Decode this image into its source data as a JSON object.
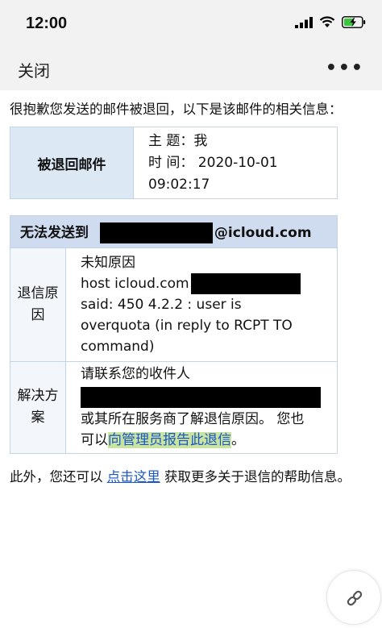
{
  "status": {
    "time": "12:00"
  },
  "nav": {
    "close_label": "关闭",
    "more_label": "•••"
  },
  "intro": "很抱歉您发送的邮件被退回，以下是该邮件的相关信息：",
  "bounced_mail": {
    "label": "被退回邮件",
    "subject_line": "主 题：我",
    "time_line_1": "时 间： 2020-10-01",
    "time_line_2": "09:02:17"
  },
  "failure": {
    "header_prefix": "无法发送到",
    "header_suffix": "@icloud.com",
    "reason_label_1": "退信原",
    "reason_label_2": "因",
    "reason_line_1": "未知原因",
    "reason_line_2": "host icloud.com",
    "reason_line_3": "said: 450 4.2.2 : user is",
    "reason_line_4": "overquota (in reply to RCPT TO",
    "reason_line_5": "command)",
    "solution_label_1": "解决方",
    "solution_label_2": "案",
    "solution_line_1": "请联系您的收件人",
    "solution_line_3": "或其所在服务商了解退信原因。 您也",
    "solution_line_4_prefix": "可以",
    "solution_link": "向管理员报告此退信",
    "solution_line_4_suffix": "。"
  },
  "footer": {
    "prefix": "此外，您还可以 ",
    "link": "点击这里",
    "suffix": " 获取更多关于退信的帮助信息。"
  },
  "colors": {
    "accent": "#1a56c7",
    "highlight": "#c9e3a0",
    "table_header": "#cfdcf0"
  }
}
